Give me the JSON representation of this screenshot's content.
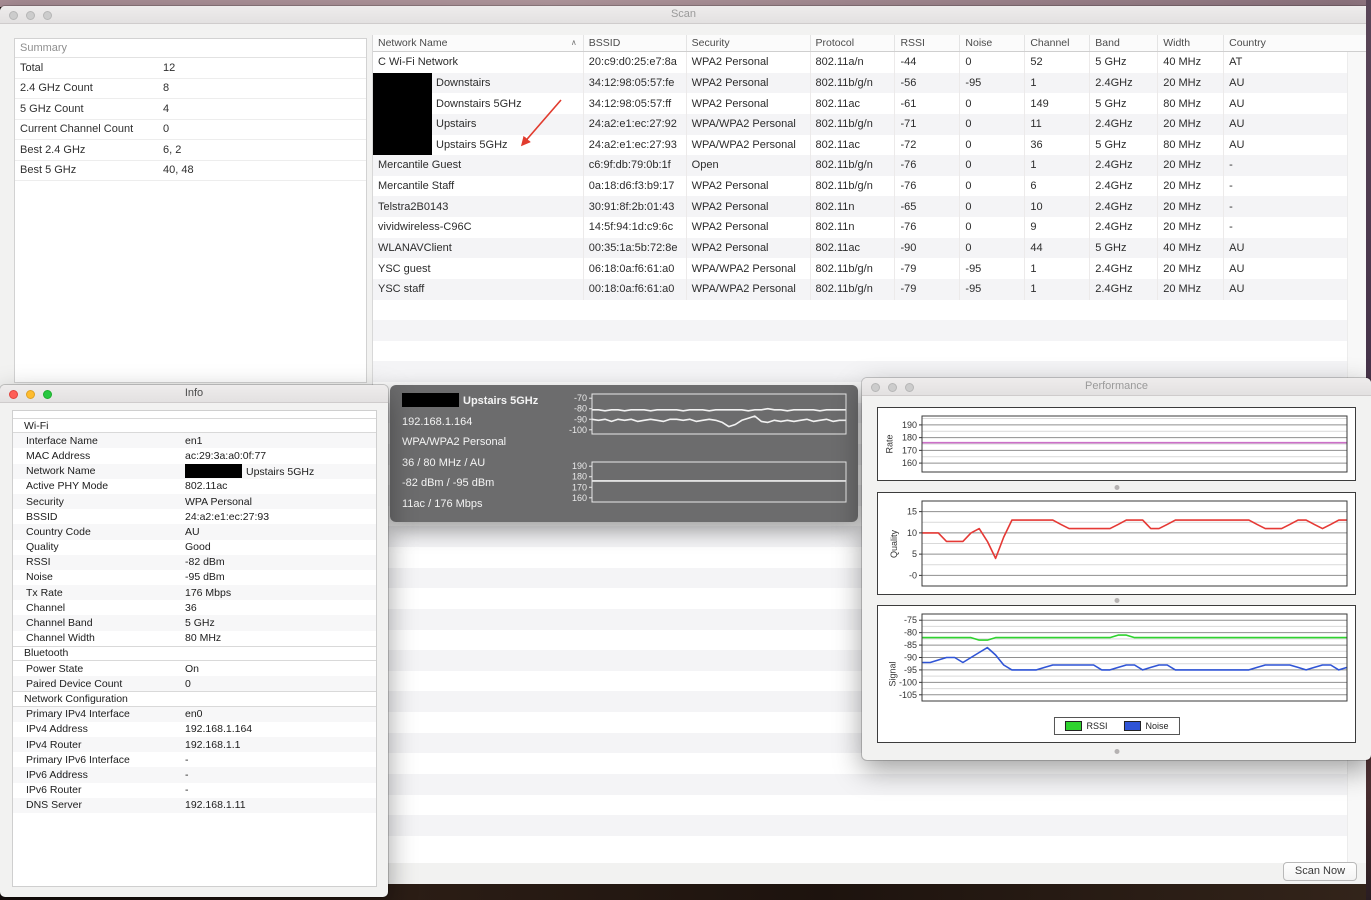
{
  "desktop": {
    "top_strip_color": "#a88d95",
    "bottom_color": "#1d130e",
    "right_strip_color": "#46334a"
  },
  "scan_window": {
    "title": "Scan",
    "summary": {
      "title": "Summary",
      "rows": [
        {
          "label": "Total",
          "value": "12"
        },
        {
          "label": "2.4 GHz Count",
          "value": "8"
        },
        {
          "label": "5 GHz Count",
          "value": "4"
        },
        {
          "label": "Current Channel Count",
          "value": "0"
        },
        {
          "label": "Best 2.4 GHz",
          "value": "6, 2"
        },
        {
          "label": "Best 5 GHz",
          "value": "40, 48"
        }
      ]
    },
    "table": {
      "columns": [
        "Network Name",
        "BSSID",
        "Security",
        "Protocol",
        "RSSI",
        "Noise",
        "Channel",
        "Band",
        "Width",
        "Country"
      ],
      "sort_column": "Network Name",
      "sort_indicator": "ascending",
      "rows": [
        {
          "name": "C Wi-Fi Network",
          "redacted": false,
          "bssid": "20:c9:d0:25:e7:8a",
          "security": "WPA2 Personal",
          "protocol": "802.11a/n",
          "rssi": "-44",
          "noise": "0",
          "channel": "52",
          "band": "5 GHz",
          "width": "40 MHz",
          "country": "AT"
        },
        {
          "name": "Downstairs",
          "redacted": true,
          "bssid": "34:12:98:05:57:fe",
          "security": "WPA2 Personal",
          "protocol": "802.11b/g/n",
          "rssi": "-56",
          "noise": "-95",
          "channel": "1",
          "band": "2.4GHz",
          "width": "20 MHz",
          "country": "AU"
        },
        {
          "name": "Downstairs 5GHz",
          "redacted": true,
          "bssid": "34:12:98:05:57:ff",
          "security": "WPA2 Personal",
          "protocol": "802.11ac",
          "rssi": "-61",
          "noise": "0",
          "channel": "149",
          "band": "5 GHz",
          "width": "80 MHz",
          "country": "AU"
        },
        {
          "name": "Upstairs",
          "redacted": true,
          "bssid": "24:a2:e1:ec:27:92",
          "security": "WPA/WPA2 Personal",
          "protocol": "802.11b/g/n",
          "rssi": "-71",
          "noise": "0",
          "channel": "11",
          "band": "2.4GHz",
          "width": "20 MHz",
          "country": "AU"
        },
        {
          "name": "Upstairs 5GHz",
          "redacted": true,
          "bssid": "24:a2:e1:ec:27:93",
          "security": "WPA/WPA2 Personal",
          "protocol": "802.11ac",
          "rssi": "-72",
          "noise": "0",
          "channel": "36",
          "band": "5 GHz",
          "width": "80 MHz",
          "country": "AU"
        },
        {
          "name": "Mercantile Guest",
          "redacted": false,
          "bssid": "c6:9f:db:79:0b:1f",
          "security": "Open",
          "protocol": "802.11b/g/n",
          "rssi": "-76",
          "noise": "0",
          "channel": "1",
          "band": "2.4GHz",
          "width": "20 MHz",
          "country": "-"
        },
        {
          "name": "Mercantile Staff",
          "redacted": false,
          "bssid": "0a:18:d6:f3:b9:17",
          "security": "WPA2 Personal",
          "protocol": "802.11b/g/n",
          "rssi": "-76",
          "noise": "0",
          "channel": "6",
          "band": "2.4GHz",
          "width": "20 MHz",
          "country": "-"
        },
        {
          "name": "Telstra2B0143",
          "redacted": false,
          "bssid": "30:91:8f:2b:01:43",
          "security": "WPA2 Personal",
          "protocol": "802.11n",
          "rssi": "-65",
          "noise": "0",
          "channel": "10",
          "band": "2.4GHz",
          "width": "20 MHz",
          "country": "-"
        },
        {
          "name": "vividwireless-C96C",
          "redacted": false,
          "bssid": "14:5f:94:1d:c9:6c",
          "security": "WPA2 Personal",
          "protocol": "802.11n",
          "rssi": "-76",
          "noise": "0",
          "channel": "9",
          "band": "2.4GHz",
          "width": "20 MHz",
          "country": "-"
        },
        {
          "name": "WLANAVClient",
          "redacted": false,
          "bssid": "00:35:1a:5b:72:8e",
          "security": "WPA2 Personal",
          "protocol": "802.11ac",
          "rssi": "-90",
          "noise": "0",
          "channel": "44",
          "band": "5 GHz",
          "width": "40 MHz",
          "country": "AU"
        },
        {
          "name": "YSC guest",
          "redacted": false,
          "bssid": "06:18:0a:f6:61:a0",
          "security": "WPA/WPA2 Personal",
          "protocol": "802.11b/g/n",
          "rssi": "-79",
          "noise": "-95",
          "channel": "1",
          "band": "2.4GHz",
          "width": "20 MHz",
          "country": "AU"
        },
        {
          "name": "YSC staff",
          "redacted": false,
          "bssid": "00:18:0a:f6:61:a0",
          "security": "WPA/WPA2 Personal",
          "protocol": "802.11b/g/n",
          "rssi": "-79",
          "noise": "-95",
          "channel": "1",
          "band": "2.4GHz",
          "width": "20 MHz",
          "country": "AU"
        }
      ]
    },
    "scan_now_label": "Scan Now"
  },
  "info_window": {
    "title": "Info",
    "sections": [
      {
        "header": "Wi-Fi",
        "rows": [
          {
            "label": "Interface Name",
            "value": "en1"
          },
          {
            "label": "MAC Address",
            "value": "ac:29:3a:a0:0f:77"
          },
          {
            "label": "Network Name",
            "value": "Upstairs 5GHz",
            "redacted": true
          },
          {
            "label": "Active PHY Mode",
            "value": "802.11ac"
          },
          {
            "label": "Security",
            "value": "WPA Personal"
          },
          {
            "label": "BSSID",
            "value": "24:a2:e1:ec:27:93"
          },
          {
            "label": "Country Code",
            "value": "AU"
          },
          {
            "label": "Quality",
            "value": "Good"
          },
          {
            "label": "RSSI",
            "value": "-82 dBm"
          },
          {
            "label": "Noise",
            "value": "-95 dBm"
          },
          {
            "label": "Tx Rate",
            "value": "176 Mbps"
          },
          {
            "label": "Channel",
            "value": "36"
          },
          {
            "label": "Channel Band",
            "value": "5 GHz"
          },
          {
            "label": "Channel Width",
            "value": "80 MHz"
          }
        ]
      },
      {
        "header": "Bluetooth",
        "rows": [
          {
            "label": "Power State",
            "value": "On"
          },
          {
            "label": "Paired Device Count",
            "value": "0"
          }
        ]
      },
      {
        "header": "Network Configuration",
        "rows": [
          {
            "label": "Primary IPv4 Interface",
            "value": "en0"
          },
          {
            "label": "IPv4 Address",
            "value": "192.168.1.164"
          },
          {
            "label": "IPv4 Router",
            "value": "192.168.1.1"
          },
          {
            "label": "Primary IPv6 Interface",
            "value": "-"
          },
          {
            "label": "IPv6 Address",
            "value": "-"
          },
          {
            "label": "IPv6 Router",
            "value": "-"
          },
          {
            "label": "DNS Server",
            "value": "192.168.1.11"
          }
        ]
      }
    ]
  },
  "tooltip": {
    "title": "Upstairs 5GHz",
    "title_redacted": true,
    "lines": [
      "192.168.1.164",
      "WPA/WPA2 Personal",
      "36 / 80 MHz / AU",
      "-82 dBm / -95 dBm",
      "11ac / 176 Mbps"
    ]
  },
  "performance_window": {
    "title": "Performance",
    "legend": [
      {
        "label": "RSSI",
        "color": "#2fd32f"
      },
      {
        "label": "Noise",
        "color": "#2f54d6"
      }
    ]
  },
  "chart_data": [
    {
      "id": "performance-rate",
      "type": "line",
      "ylabel": "Rate",
      "ylim": [
        153,
        197
      ],
      "yticks": [
        {
          "v": 190,
          "l": "190"
        },
        {
          "v": 180,
          "l": "180"
        },
        {
          "v": 170,
          "l": "170"
        },
        {
          "v": 160,
          "l": "160"
        }
      ],
      "minor": [
        195,
        185,
        175,
        165
      ],
      "series": [
        {
          "name": "Tx Rate (Mbps)",
          "color": "#cc70c8",
          "values": [
            176,
            176,
            176,
            176,
            176,
            176,
            176,
            176,
            176,
            176,
            176,
            176,
            176,
            176,
            176,
            176,
            176,
            176,
            176,
            176,
            176,
            176,
            176,
            176,
            176,
            176,
            176,
            176,
            176,
            176
          ]
        }
      ]
    },
    {
      "id": "performance-quality",
      "type": "line",
      "ylabel": "Quality",
      "ylim": [
        -2.5,
        17.5
      ],
      "yticks": [
        {
          "v": 15,
          "l": "15"
        },
        {
          "v": 10,
          "l": "10"
        },
        {
          "v": 5,
          "l": "5"
        },
        {
          "v": 0,
          "l": "-0"
        }
      ],
      "minor": [
        12.5,
        7.5,
        2.5
      ],
      "series": [
        {
          "name": "Quality",
          "color": "#e53935",
          "values": [
            10,
            10,
            10,
            8,
            8,
            8,
            10,
            11,
            8,
            4,
            9,
            13,
            13,
            13,
            13,
            13,
            13,
            12,
            11,
            11,
            11,
            11,
            11,
            11,
            12,
            13,
            13,
            13,
            11,
            11,
            12,
            13,
            13,
            13,
            13,
            13,
            13,
            13,
            13,
            13,
            13,
            12,
            11,
            11,
            11,
            12,
            13,
            13,
            12,
            11,
            12,
            13,
            13
          ]
        }
      ]
    },
    {
      "id": "performance-signal",
      "type": "line",
      "ylabel": "Signal",
      "ylim": [
        -107.5,
        -72.5
      ],
      "yticks": [
        {
          "v": -75,
          "l": "-75"
        },
        {
          "v": -80,
          "l": "-80"
        },
        {
          "v": -85,
          "l": "-85"
        },
        {
          "v": -90,
          "l": "-90"
        },
        {
          "v": -95,
          "l": "-95"
        },
        {
          "v": -100,
          "l": "-100"
        },
        {
          "v": -105,
          "l": "-105"
        }
      ],
      "minor": [
        -77.5,
        -82.5,
        -87.5,
        -92.5,
        -97.5,
        -102.5
      ],
      "legend_position": "bottom",
      "series": [
        {
          "name": "RSSI",
          "color": "#2fd32f",
          "values": [
            -82,
            -82,
            -82,
            -82,
            -82,
            -82,
            -82,
            -83,
            -83,
            -82,
            -82,
            -82,
            -82,
            -82,
            -82,
            -82,
            -82,
            -82,
            -82,
            -82,
            -82,
            -82,
            -82,
            -82,
            -81,
            -81,
            -82,
            -82,
            -82,
            -82,
            -82,
            -82,
            -82,
            -82,
            -82,
            -82,
            -82,
            -82,
            -82,
            -82,
            -82,
            -82,
            -82,
            -82,
            -82,
            -82,
            -82,
            -82,
            -82,
            -82,
            -82,
            -82,
            -82
          ]
        },
        {
          "name": "Noise",
          "color": "#2f54d6",
          "values": [
            -92,
            -92,
            -91,
            -90,
            -90,
            -92,
            -90,
            -88,
            -86,
            -89,
            -93,
            -95,
            -95,
            -95,
            -95,
            -94,
            -93,
            -93,
            -93,
            -93,
            -93,
            -93,
            -95,
            -95,
            -94,
            -93,
            -93,
            -95,
            -94,
            -93,
            -93,
            -95,
            -95,
            -95,
            -95,
            -95,
            -95,
            -95,
            -95,
            -95,
            -95,
            -94,
            -93,
            -93,
            -93,
            -93,
            -94,
            -95,
            -94,
            -93,
            -93,
            -95,
            -94
          ]
        }
      ]
    },
    {
      "id": "tooltip-signal",
      "type": "line",
      "ylim": [
        -104,
        -66
      ],
      "yticks": [
        {
          "v": -70,
          "l": "-70"
        },
        {
          "v": -80,
          "l": "-80"
        },
        {
          "v": -90,
          "l": "-90"
        },
        {
          "v": -100,
          "l": "-100"
        }
      ],
      "grid": false,
      "frame_color": "#e9e9e9",
      "tick_color": "#e9e9e9",
      "axis_color": "#e9e9e9",
      "series": [
        {
          "name": "RSSI",
          "color": "#f2f2f2",
          "values": [
            -81,
            -81,
            -82,
            -81,
            -81,
            -82,
            -81,
            -81,
            -81,
            -82,
            -81,
            -81,
            -81,
            -81,
            -82,
            -81,
            -81,
            -81,
            -82,
            -81,
            -81,
            -81,
            -81,
            -81,
            -82,
            -81,
            -81,
            -80,
            -81,
            -81,
            -82,
            -81,
            -81,
            -81,
            -81,
            -82,
            -81,
            -81,
            -81,
            -81
          ]
        },
        {
          "name": "Noise",
          "color": "#f2f2f2",
          "values": [
            -90,
            -91,
            -90,
            -92,
            -90,
            -91,
            -90,
            -92,
            -91,
            -90,
            -91,
            -92,
            -90,
            -90,
            -91,
            -90,
            -92,
            -91,
            -90,
            -91,
            -93,
            -97,
            -95,
            -91,
            -89,
            -87,
            -92,
            -93,
            -91,
            -92,
            -91,
            -92,
            -91,
            -90,
            -92,
            -91,
            -90,
            -92,
            -91,
            -91
          ]
        }
      ]
    },
    {
      "id": "tooltip-rate",
      "type": "line",
      "ylim": [
        156,
        194
      ],
      "yticks": [
        {
          "v": 190,
          "l": "190"
        },
        {
          "v": 180,
          "l": "180"
        },
        {
          "v": 170,
          "l": "170"
        },
        {
          "v": 160,
          "l": "160"
        }
      ],
      "grid": false,
      "frame_color": "#e9e9e9",
      "tick_color": "#e9e9e9",
      "axis_color": "#e9e9e9",
      "series": [
        {
          "name": "Tx Rate",
          "color": "#f2f2f2",
          "values": [
            176,
            176,
            176,
            176,
            176,
            176,
            176,
            176,
            176,
            176,
            176,
            176,
            176,
            176,
            176,
            176,
            176,
            176,
            176,
            176
          ]
        }
      ]
    }
  ]
}
